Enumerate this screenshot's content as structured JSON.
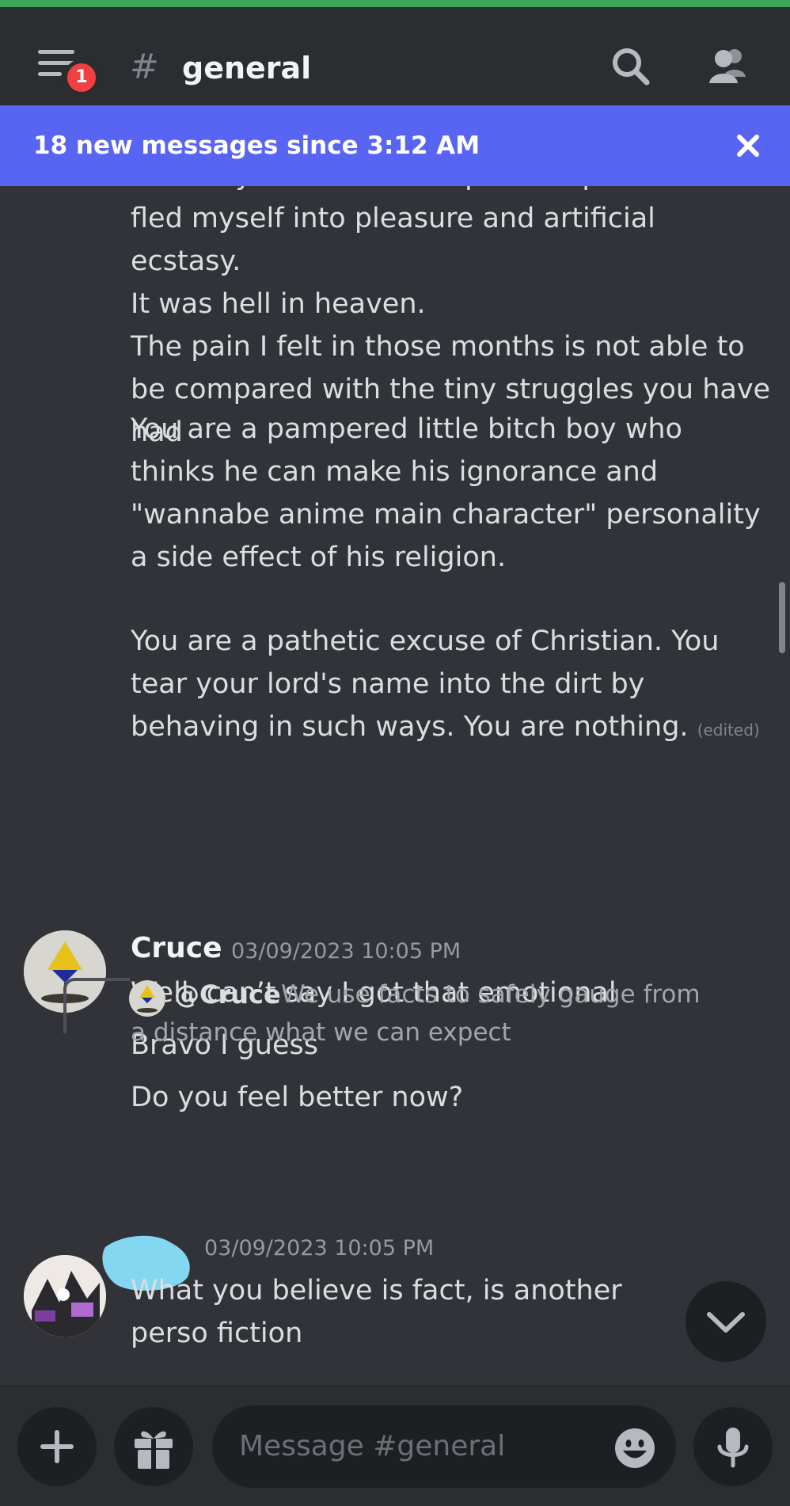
{
  "header": {
    "menu_badge": "1",
    "hash": "#",
    "channel_name": "general"
  },
  "banner": {
    "text": "18 new messages since 3:12 AM"
  },
  "messages": {
    "partial_top": "mentally. It fucked me up to the point where I",
    "block1": "fled myself into pleasure and artificial ecstasy.\nIt was hell in heaven.\nThe pain I felt in those months is not able to be compared with the tiny struggles you have had",
    "block2": "You are a pampered little bitch boy who thinks he can make his ignorance and \"wannabe anime main character\" personality a side effect of his religion.",
    "block3": "You are a pathetic excuse of  Christian. You tear your lord's name into the dirt by behaving in such ways. You are nothing.",
    "edited": "(edited)",
    "cruce": {
      "username": "Cruce",
      "timestamp": "03/09/2023 10:05 PM",
      "lines": [
        "Well, can’t say I got that emotional",
        "Bravo I guess",
        "Do you feel better now?"
      ]
    },
    "reply": {
      "mention": "@Cruce",
      "text": "We use facts to safely gauge from a distance what we can expect"
    },
    "last": {
      "timestamp": "03/09/2023 10:05 PM",
      "text": "What you believe is fact, is another perso fiction"
    }
  },
  "composer": {
    "placeholder": "Message #general"
  }
}
